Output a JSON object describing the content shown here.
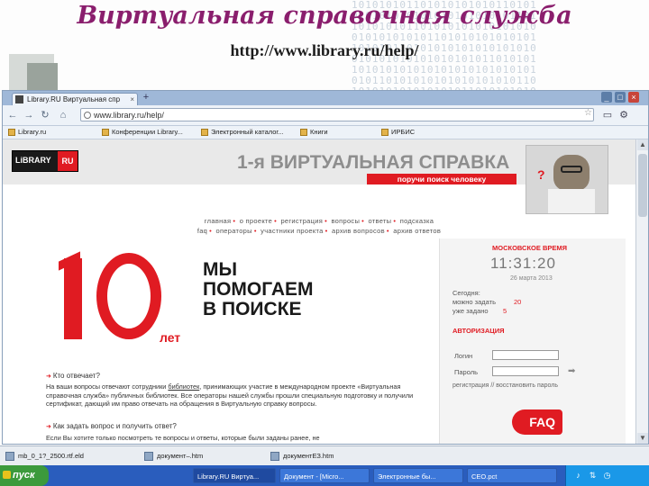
{
  "slide": {
    "title": "Виртуальная справочная служба",
    "url": "http://www.library.ru/help/",
    "binary": "101010101101010101010110101\n010101010101010101010101101\n101010101101010101010101010\n010101010101101010101010101\n101010110101010101010101010\n010101010101010101011010101\n101010101010101010101010101\n010110101010101010101010110\n101010101010101011010101010"
  },
  "browser": {
    "tab_title": "Library.RU Виртуальная спр",
    "tab_close": "×",
    "new_tab": "+",
    "address": "www.library.ru/help/",
    "bookmarks": [
      "Library.ru",
      "Конференции Library...",
      "Электронный каталог...",
      "Книги",
      "ИРБИС"
    ]
  },
  "page": {
    "logo_lib": "LiBRARY",
    "logo_ru": "RU",
    "hero_title": "1-я ВИРТУАЛЬНАЯ СПРАВКА",
    "hero_sub": "поручи поиск человеку",
    "menu_row1": [
      "главная",
      "о проекте",
      "регистрация",
      "вопросы",
      "ответы",
      "подсказка"
    ],
    "menu_row2": [
      "faq",
      "операторы",
      "участники проекта",
      "архив вопросов",
      "архив ответов"
    ],
    "ten_let": "лет",
    "slogan": [
      "МЫ",
      "ПОМОГАЕМ",
      "В ПОИСКЕ"
    ],
    "moscow_time_label": "МОСКОВСКОЕ ВРЕМЯ",
    "clock": "11:31:20",
    "date": "26 марта 2013",
    "today_label": "Сегодня:",
    "can_ask": "можно задать",
    "can_ask_num": "20",
    "already_asked": "уже задано",
    "already_asked_num": "5",
    "auth_label": "АВТОРИЗАЦИЯ",
    "login_label": "Логин",
    "password_label": "Пароль",
    "register_link": "регистрация // восстановить пароль",
    "faq_label": "FAQ",
    "who_answers_head": "Кто отвечает?",
    "who_answers_body_1": "На ваши вопросы отвечают сотрудники",
    "who_answers_link": "библиотек",
    "who_answers_body_2": ", принимающих участие в международном проекте «Виртуальная справочная служба» публичных библиотек. Все операторы нашей службы прошли специальную подготовку и получили сертификат, дающий им право отвечать на обращения в Виртуальную справку вопросы.",
    "how_ask_head": "Как задать вопрос и получить ответ?",
    "how_ask_body": "Если Вы хотите только посмотреть те вопросы и ответы, которые были заданы ранее, не"
  },
  "taskbar": {
    "downloads": [
      "mb_0_1?_2500.rtf.eld",
      "документ–.htm",
      "документЕЗ.htm"
    ],
    "start_label": "пуск",
    "tasks": [
      "Library.RU Виртуа...",
      "Документ - [Micro...",
      "Электронные бы...",
      "CEO.pct"
    ],
    "tray_icons": [
      "volume-icon",
      "network-icon",
      "clock-icon"
    ]
  }
}
